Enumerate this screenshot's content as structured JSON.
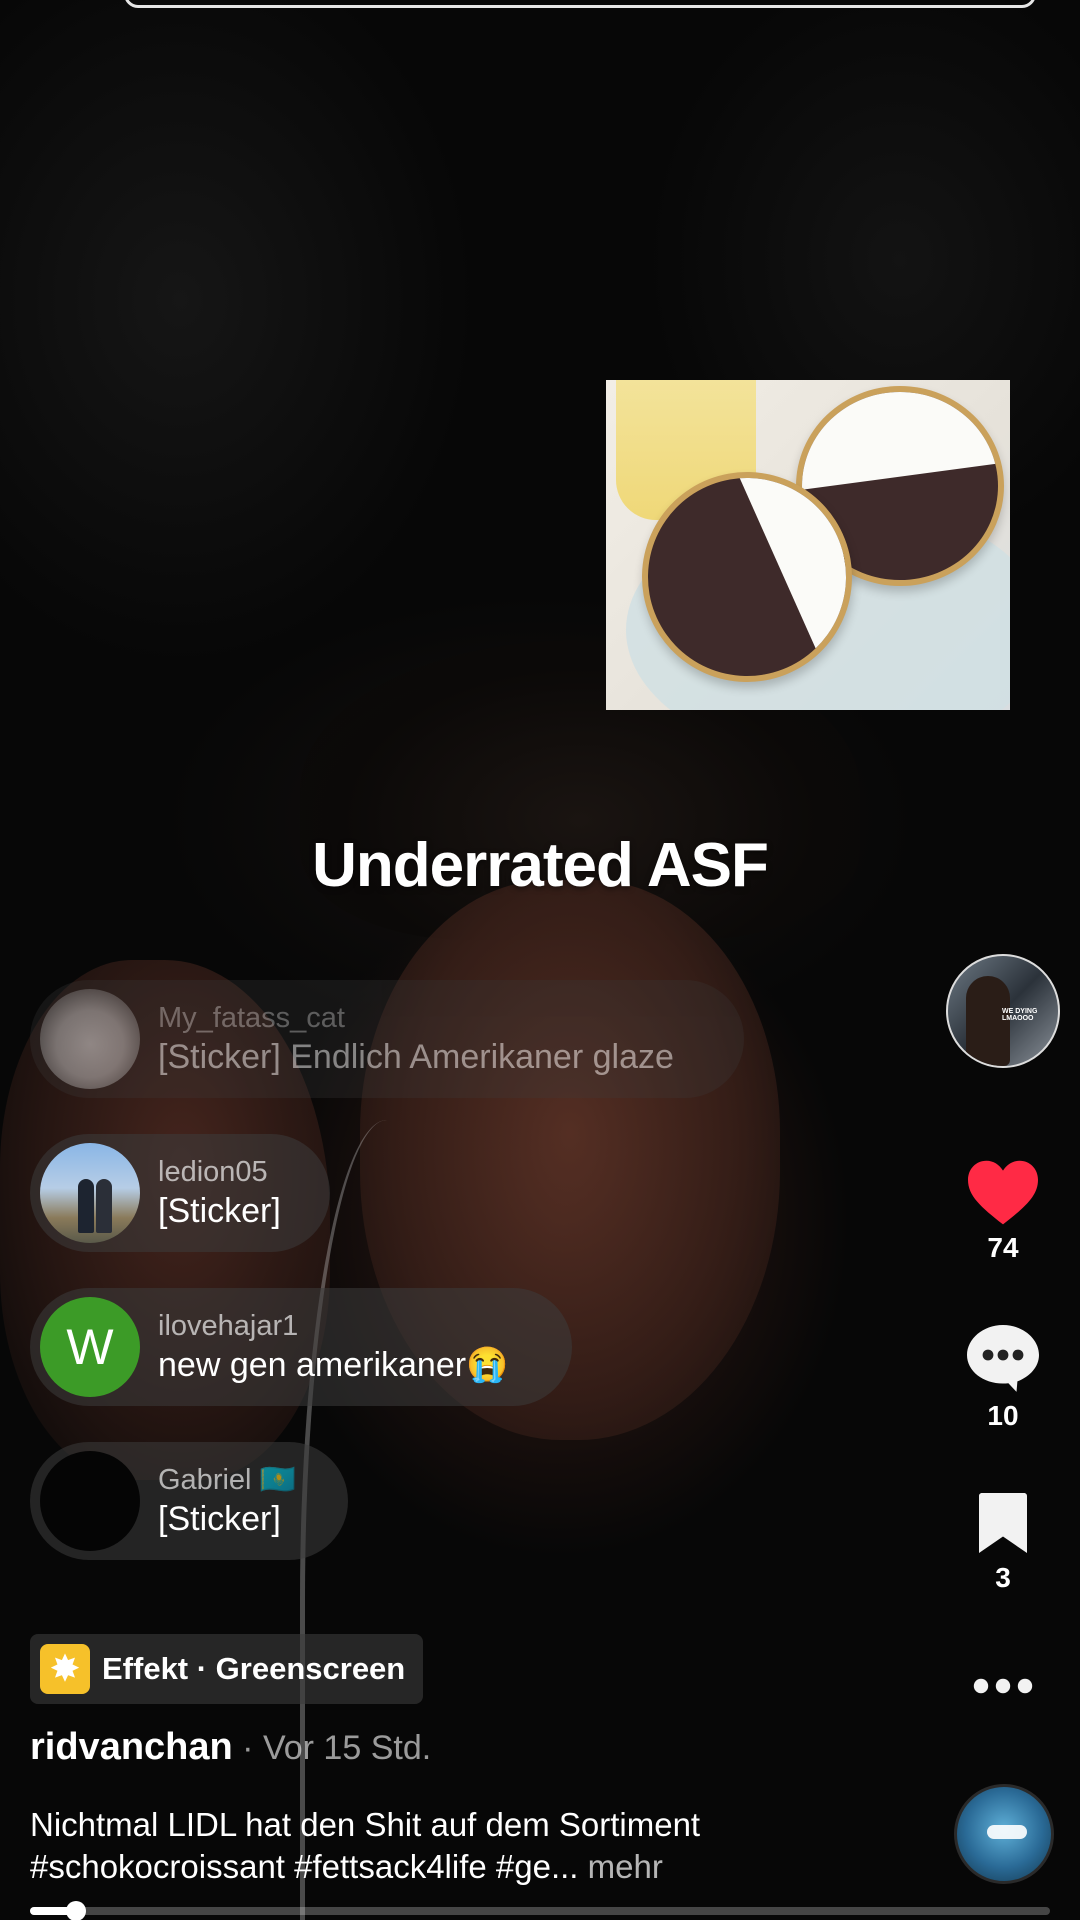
{
  "video": {
    "overlay_caption": "Underrated ASF",
    "progress_fraction": 0.045
  },
  "comments": [
    {
      "user": "My_fatass_cat",
      "message": "[Sticker] Endlich Amerikaner glaze",
      "avatar": "cat-avatar"
    },
    {
      "user": "ledion05",
      "message": "[Sticker]",
      "avatar": "couple-photo-avatar"
    },
    {
      "user": "ilovehajar1",
      "message": "new gen amerikaner😭",
      "avatar": "letter-avatar",
      "avatar_letter": "W",
      "avatar_color": "#3c9b27"
    },
    {
      "user": "Gabriel 🇰🇿",
      "message": "[Sticker]",
      "avatar": "black-avatar"
    }
  ],
  "creator_avatar": {
    "overlay_text": "WE DYING LMAOOO"
  },
  "actions": {
    "likes": "74",
    "comments": "10",
    "saves": "3",
    "like_color": "#ff2a45"
  },
  "effect": {
    "label": "Effekt · Greenscreen",
    "icon": "sparkle-icon"
  },
  "post": {
    "author": "ridvanchan",
    "time": " · Vor 15 Std.",
    "description_line1": "Nichtmal LIDL hat den Shit auf dem Sortiment",
    "description_line2": "#schokocroissant #fettsack4life #ge...",
    "more_label": " mehr"
  }
}
